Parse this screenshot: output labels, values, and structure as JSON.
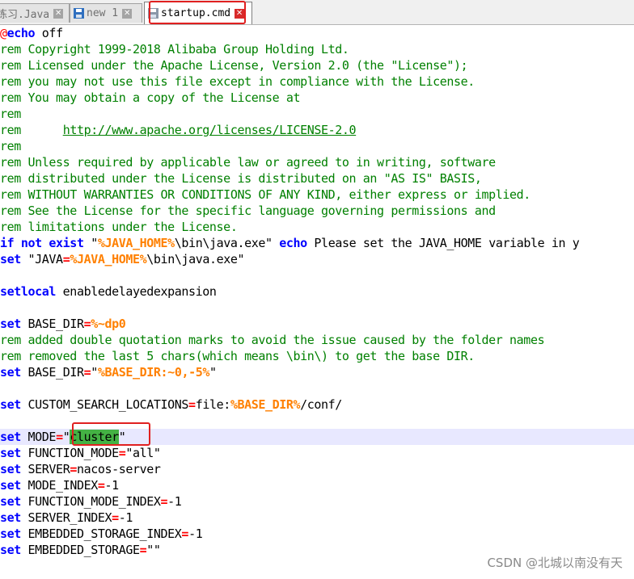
{
  "tabs": [
    {
      "label": "练习.Java",
      "icon": "save-disk-icon",
      "active": false
    },
    {
      "label": "new 1",
      "icon": "save-disk-icon",
      "active": false
    },
    {
      "label": "startup.cmd",
      "icon": "save-disk-icon",
      "active": true
    }
  ],
  "tab_close_glyph": "✕",
  "colors": {
    "comment": "#008000",
    "keyword": "#0000ff",
    "operator": "#ff0000",
    "variable": "#ff8000",
    "highlight_box": "#e02020",
    "selection": "#44b244",
    "caret_line": "#e8e8ff"
  },
  "code": {
    "l1": {
      "at": "@",
      "kw": "echo",
      "rest": " off"
    },
    "l2": "rem Copyright 1999-2018 Alibaba Group Holding Ltd.",
    "l3": "rem Licensed under the Apache License, Version 2.0 (the \"License\");",
    "l4": "rem you may not use this file except in compliance with the License.",
    "l5": "rem You may obtain a copy of the License at",
    "l6": "rem",
    "l7": {
      "pre": "rem      ",
      "url": "http://www.apache.org/licenses/LICENSE-2.0"
    },
    "l8": "rem",
    "l9": "rem Unless required by applicable law or agreed to in writing, software",
    "l10": "rem distributed under the License is distributed on an \"AS IS\" BASIS,",
    "l11": "rem WITHOUT WARRANTIES OR CONDITIONS OF ANY KIND, either express or implied.",
    "l12": "rem See the License for the specific language governing permissions and",
    "l13": "rem limitations under the License.",
    "l14": {
      "kw1": "if not exist",
      "q": " \"",
      "v": "%JAVA_HOME%",
      "path": "\\bin\\java.exe\" ",
      "kw2": "echo",
      "msg": " Please set the JAVA_HOME variable in y"
    },
    "l15": {
      "kw": "set",
      "q": " \"JAVA",
      "eq": "=",
      "v": "%JAVA_HOME%",
      "path": "\\bin\\java.exe\""
    },
    "l17": {
      "kw": "setlocal",
      "rest": " enabledelayedexpansion"
    },
    "l19": {
      "kw": "set",
      "name": " BASE_DIR",
      "eq": "=",
      "v": "%~dp0"
    },
    "l20": "rem added double quotation marks to avoid the issue caused by the folder names",
    "l21": "rem removed the last 5 chars(which means \\bin\\) to get the base DIR.",
    "l22": {
      "kw": "set",
      "name": " BASE_DIR",
      "eq": "=",
      "q1": "\"",
      "v": "%BASE_DIR:~0,-5%",
      "q2": "\""
    },
    "l24": {
      "kw": "set",
      "name": " CUSTOM_SEARCH_LOCATIONS",
      "eq": "=",
      "pre": "file:",
      "v": "%BASE_DIR%",
      "post": "/conf/"
    },
    "l26": {
      "kw": "set",
      "name": " MODE",
      "eq": "=",
      "q1": "\"",
      "sel": "cluster",
      "q2": "\""
    },
    "l27": {
      "kw": "set",
      "name": " FUNCTION_MODE",
      "eq": "=",
      "val": "\"all\""
    },
    "l28": {
      "kw": "set",
      "name": " SERVER",
      "eq": "=",
      "val": "nacos-server"
    },
    "l29": {
      "kw": "set",
      "name": " MODE_INDEX",
      "eq": "=",
      "val": "-1"
    },
    "l30": {
      "kw": "set",
      "name": " FUNCTION_MODE_INDEX",
      "eq": "=",
      "val": "-1"
    },
    "l31": {
      "kw": "set",
      "name": " SERVER_INDEX",
      "eq": "=",
      "val": "-1"
    },
    "l32": {
      "kw": "set",
      "name": " EMBEDDED_STORAGE_INDEX",
      "eq": "=",
      "val": "-1"
    },
    "l33": {
      "kw": "set",
      "name": " EMBEDDED_STORAGE",
      "eq": "=",
      "val": "\"\""
    }
  },
  "watermark": "CSDN @北城以南没有天"
}
